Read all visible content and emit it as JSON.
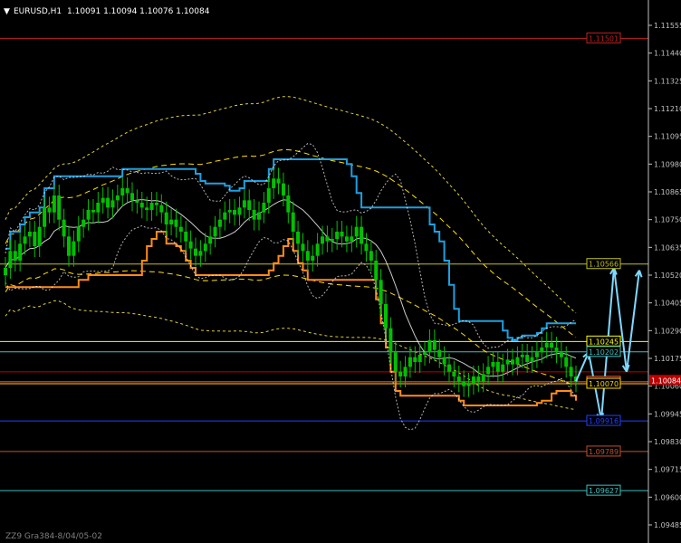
{
  "header": {
    "symbol_label": "EURUSD,H1",
    "ohlc": "1.10091 1.10094 1.10076 1.10084",
    "dropdown_glyph": "▼"
  },
  "footer": {
    "indicator_text": "ZZ9 Gra384-8/04/05-02"
  },
  "colors": {
    "background": "#000000",
    "axis": "#c0c0c0",
    "candle": "#00c000",
    "channel_upper": "#1ea0e0",
    "channel_lower": "#ff8c1a",
    "band_inner": "#ffffff",
    "band_outer": "#ffffff",
    "forecast_arrows": "#7fd8ff",
    "dashed_outer": "#e0d040",
    "dashed_inner": "#ffe000"
  },
  "chart_data": {
    "type": "candlestick",
    "symbol": "EURUSD",
    "timeframe": "H1",
    "ylim": [
      1.0941,
      1.1166
    ],
    "yticks": [
      "1.11555",
      "1.11440",
      "1.11325",
      "1.11210",
      "1.11095",
      "1.10980",
      "1.10865",
      "1.10750",
      "1.10635",
      "1.10520",
      "1.10405",
      "1.10290",
      "1.10175",
      "1.10060",
      "1.09945",
      "1.09830",
      "1.09715",
      "1.09600",
      "1.09485"
    ],
    "current_price": "1.10084",
    "levels": [
      {
        "price": 1.11501,
        "label": "1.11501",
        "color": "#c02020"
      },
      {
        "price": 1.10566,
        "label": "1.10566",
        "color": "#c0c020"
      },
      {
        "price": 1.10245,
        "label": "1.10245",
        "color": "#ffff00"
      },
      {
        "price": 1.10202,
        "label": "1.10202",
        "color": "#40c0c0"
      },
      {
        "price": 1.10119,
        "label": "",
        "color": "#c00000"
      },
      {
        "price": 1.10078,
        "label": "1.10078",
        "color": "#ff6030"
      },
      {
        "price": 1.1007,
        "label": "1.10070",
        "color": "#ffd700"
      },
      {
        "price": 1.09916,
        "label": "1.09916",
        "color": "#2040ff"
      },
      {
        "price": 1.09789,
        "label": "1.09789",
        "color": "#c05030"
      },
      {
        "price": 1.09627,
        "label": "1.09627",
        "color": "#40c0c0"
      }
    ],
    "closes": [
      1.1055,
      1.1062,
      1.1058,
      1.1065,
      1.1068,
      1.107,
      1.1064,
      1.1072,
      1.108,
      1.1078,
      1.1085,
      1.1075,
      1.1068,
      1.106,
      1.1066,
      1.1072,
      1.1075,
      1.1079,
      1.1078,
      1.1082,
      1.1084,
      1.108,
      1.1083,
      1.1085,
      1.1088,
      1.1086,
      1.1083,
      1.1082,
      1.108,
      1.1079,
      1.1082,
      1.1081,
      1.1078,
      1.1073,
      1.1075,
      1.1072,
      1.107,
      1.1066,
      1.1063,
      1.106,
      1.1062,
      1.1065,
      1.1068,
      1.1072,
      1.1075,
      1.1078,
      1.1079,
      1.1077,
      1.108,
      1.1083,
      1.1079,
      1.1075,
      1.1078,
      1.1082,
      1.1088,
      1.1092,
      1.109,
      1.1085,
      1.1078,
      1.107,
      1.1065,
      1.1062,
      1.1058,
      1.106,
      1.1065,
      1.1068,
      1.1066,
      1.1067,
      1.107,
      1.1068,
      1.1066,
      1.1068,
      1.1072,
      1.1065,
      1.1062,
      1.1058,
      1.105,
      1.104,
      1.103,
      1.102,
      1.1012,
      1.101,
      1.1014,
      1.1018,
      1.1016,
      1.1019,
      1.102,
      1.1025,
      1.1021,
      1.1018,
      1.1015,
      1.1012,
      1.101,
      1.1008,
      1.1006,
      1.1007,
      1.101,
      1.1008,
      1.1011,
      1.1014,
      1.1016,
      1.1012,
      1.1015,
      1.1017,
      1.1015,
      1.1018,
      1.1019,
      1.1016,
      1.1018,
      1.102,
      1.1022,
      1.1024,
      1.1022,
      1.102,
      1.1018,
      1.1014,
      1.101,
      1.1008
    ],
    "forecast_path": [
      1.1008,
      1.102,
      1.0992,
      1.1055,
      1.1012,
      1.1054
    ]
  }
}
